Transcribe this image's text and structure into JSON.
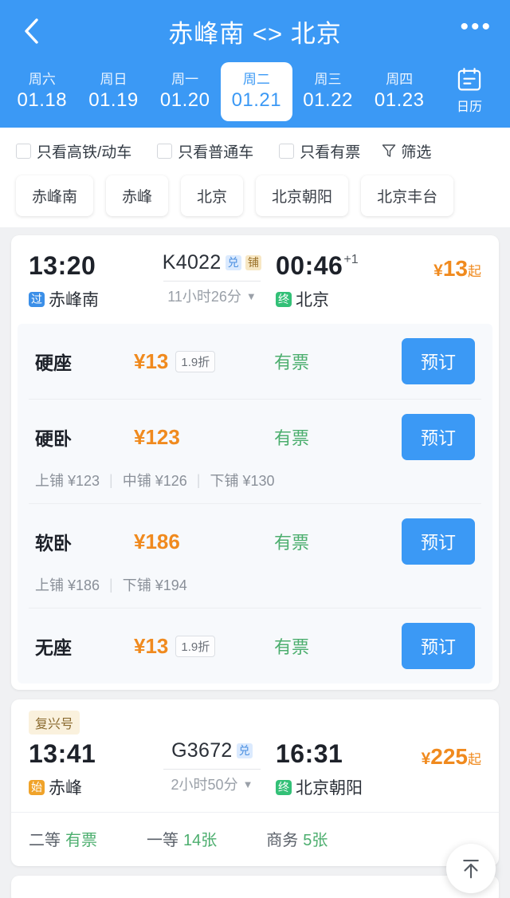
{
  "header": {
    "back_icon": "chevron-left-icon",
    "title": "赤峰南 <> 北京",
    "more_icon": "more-horizontal-icon",
    "dates": [
      {
        "dow": "周六",
        "date": "01.18",
        "active": false
      },
      {
        "dow": "周日",
        "date": "01.19",
        "active": false
      },
      {
        "dow": "周一",
        "date": "01.20",
        "active": false
      },
      {
        "dow": "周二",
        "date": "01.21",
        "active": true
      },
      {
        "dow": "周三",
        "date": "01.22",
        "active": false
      },
      {
        "dow": "周四",
        "date": "01.23",
        "active": false
      }
    ],
    "calendar": {
      "icon": "calendar-icon",
      "label": "日历"
    }
  },
  "filters": {
    "checkboxes": [
      {
        "label": "只看高铁/动车",
        "checked": false
      },
      {
        "label": "只看普通车",
        "checked": false
      },
      {
        "label": "只看有票",
        "checked": false
      }
    ],
    "filter_button": {
      "icon": "funnel-icon",
      "label": "筛选"
    },
    "stations": [
      "赤峰南",
      "赤峰",
      "北京",
      "北京朝阳",
      "北京丰台"
    ]
  },
  "trains": [
    {
      "tag_label": "",
      "depart_time": "13:20",
      "depart_tag": "过",
      "depart_station": "赤峰南",
      "train_no": "K4022",
      "badges": [
        {
          "text": "兑",
          "style": "dui"
        },
        {
          "text": "铺",
          "style": "pu"
        }
      ],
      "duration": "11小时26分",
      "duration_caret": "▼",
      "arrive_time": "00:46",
      "arrive_day_offset": "+1",
      "arrive_tag": "终",
      "arrive_station": "北京",
      "price_currency": "¥",
      "price_amount": "13",
      "price_suffix": "起",
      "seats": [
        {
          "name": "硬座",
          "price": "¥13",
          "discount": "1.9折",
          "availability": "有票",
          "book_label": "预订",
          "berths": []
        },
        {
          "name": "硬卧",
          "price": "¥123",
          "discount": "",
          "availability": "有票",
          "book_label": "预订",
          "berths": [
            "上铺 ¥123",
            "中铺 ¥126",
            "下铺 ¥130"
          ]
        },
        {
          "name": "软卧",
          "price": "¥186",
          "discount": "",
          "availability": "有票",
          "book_label": "预订",
          "berths": [
            "上铺 ¥186",
            "下铺 ¥194"
          ]
        },
        {
          "name": "无座",
          "price": "¥13",
          "discount": "1.9折",
          "availability": "有票",
          "book_label": "预订",
          "berths": []
        }
      ]
    },
    {
      "tag_label": "复兴号",
      "depart_time": "13:41",
      "depart_tag": "始",
      "depart_station": "赤峰",
      "train_no": "G3672",
      "badges": [
        {
          "text": "兑",
          "style": "dui"
        }
      ],
      "duration": "2小时50分",
      "duration_caret": "▼",
      "arrive_time": "16:31",
      "arrive_day_offset": "",
      "arrive_tag": "终",
      "arrive_station": "北京朝阳",
      "price_currency": "¥",
      "price_amount": "225",
      "price_suffix": "起",
      "summary": [
        {
          "label": "二等",
          "value": "有票"
        },
        {
          "label": "一等",
          "value": "14张"
        },
        {
          "label": "商务",
          "value": "5张"
        }
      ]
    }
  ],
  "fab": {
    "icon": "scroll-to-top-icon"
  },
  "colors": {
    "brand_blue": "#3b99f5",
    "price_orange": "#f08a1e",
    "available_green": "#4cae6e",
    "page_bg": "#f0f1f3"
  }
}
